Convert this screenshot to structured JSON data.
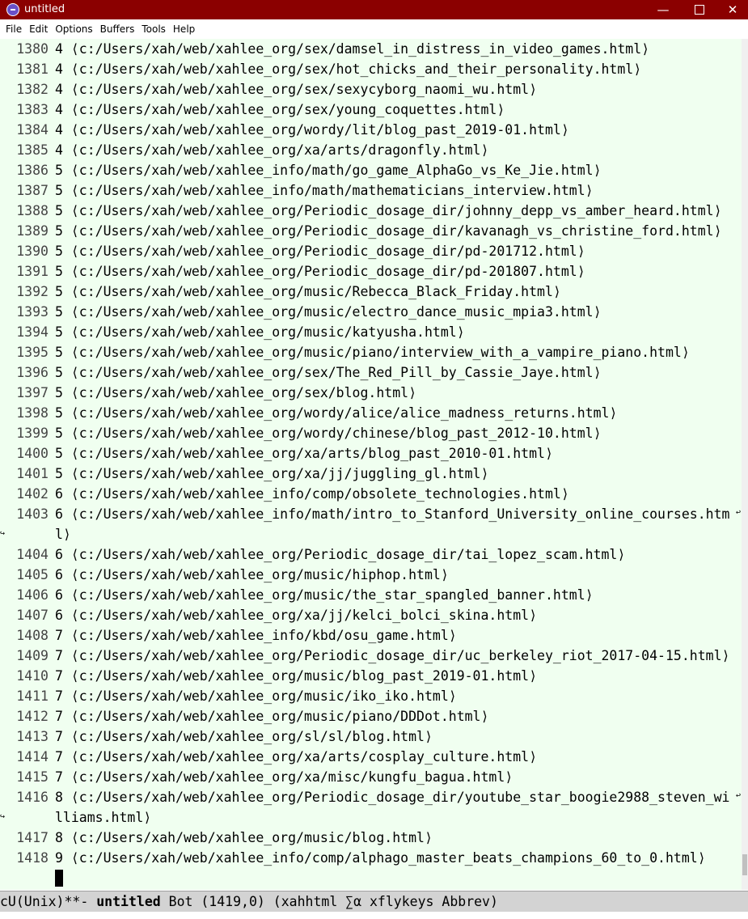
{
  "window": {
    "title": "untitled",
    "minimize_glyph": "—",
    "close_glyph": "✕"
  },
  "menu": [
    "File",
    "Edit",
    "Options",
    "Buffers",
    "Tools",
    "Help"
  ],
  "lines": [
    {
      "num": "1380",
      "text": "4 ⟨c:/Users/xah/web/xahlee_org/sex/damsel_in_distress_in_video_games.html⟩"
    },
    {
      "num": "1381",
      "text": "4 ⟨c:/Users/xah/web/xahlee_org/sex/hot_chicks_and_their_personality.html⟩"
    },
    {
      "num": "1382",
      "text": "4 ⟨c:/Users/xah/web/xahlee_org/sex/sexycyborg_naomi_wu.html⟩"
    },
    {
      "num": "1383",
      "text": "4 ⟨c:/Users/xah/web/xahlee_org/sex/young_coquettes.html⟩"
    },
    {
      "num": "1384",
      "text": "4 ⟨c:/Users/xah/web/xahlee_org/wordy/lit/blog_past_2019-01.html⟩"
    },
    {
      "num": "1385",
      "text": "4 ⟨c:/Users/xah/web/xahlee_org/xa/arts/dragonfly.html⟩"
    },
    {
      "num": "1386",
      "text": "5 ⟨c:/Users/xah/web/xahlee_info/math/go_game_AlphaGo_vs_Ke_Jie.html⟩"
    },
    {
      "num": "1387",
      "text": "5 ⟨c:/Users/xah/web/xahlee_info/math/mathematicians_interview.html⟩"
    },
    {
      "num": "1388",
      "text": "5 ⟨c:/Users/xah/web/xahlee_org/Periodic_dosage_dir/johnny_depp_vs_amber_heard.html⟩"
    },
    {
      "num": "1389",
      "text": "5 ⟨c:/Users/xah/web/xahlee_org/Periodic_dosage_dir/kavanagh_vs_christine_ford.html⟩"
    },
    {
      "num": "1390",
      "text": "5 ⟨c:/Users/xah/web/xahlee_org/Periodic_dosage_dir/pd-201712.html⟩"
    },
    {
      "num": "1391",
      "text": "5 ⟨c:/Users/xah/web/xahlee_org/Periodic_dosage_dir/pd-201807.html⟩"
    },
    {
      "num": "1392",
      "text": "5 ⟨c:/Users/xah/web/xahlee_org/music/Rebecca_Black_Friday.html⟩"
    },
    {
      "num": "1393",
      "text": "5 ⟨c:/Users/xah/web/xahlee_org/music/electro_dance_music_mpia3.html⟩"
    },
    {
      "num": "1394",
      "text": "5 ⟨c:/Users/xah/web/xahlee_org/music/katyusha.html⟩"
    },
    {
      "num": "1395",
      "text": "5 ⟨c:/Users/xah/web/xahlee_org/music/piano/interview_with_a_vampire_piano.html⟩"
    },
    {
      "num": "1396",
      "text": "5 ⟨c:/Users/xah/web/xahlee_org/sex/The_Red_Pill_by_Cassie_Jaye.html⟩"
    },
    {
      "num": "1397",
      "text": "5 ⟨c:/Users/xah/web/xahlee_org/sex/blog.html⟩"
    },
    {
      "num": "1398",
      "text": "5 ⟨c:/Users/xah/web/xahlee_org/wordy/alice/alice_madness_returns.html⟩"
    },
    {
      "num": "1399",
      "text": "5 ⟨c:/Users/xah/web/xahlee_org/wordy/chinese/blog_past_2012-10.html⟩"
    },
    {
      "num": "1400",
      "text": "5 ⟨c:/Users/xah/web/xahlee_org/xa/arts/blog_past_2010-01.html⟩"
    },
    {
      "num": "1401",
      "text": "5 ⟨c:/Users/xah/web/xahlee_org/xa/jj/juggling_gl.html⟩"
    },
    {
      "num": "1402",
      "text": "6 ⟨c:/Users/xah/web/xahlee_info/comp/obsolete_technologies.html⟩"
    },
    {
      "num": "1403",
      "text": "6 ⟨c:/Users/xah/web/xahlee_info/math/intro_to_Stanford_University_online_courses.htm",
      "cont": "l⟩"
    },
    {
      "num": "1404",
      "text": "6 ⟨c:/Users/xah/web/xahlee_org/Periodic_dosage_dir/tai_lopez_scam.html⟩"
    },
    {
      "num": "1405",
      "text": "6 ⟨c:/Users/xah/web/xahlee_org/music/hiphop.html⟩"
    },
    {
      "num": "1406",
      "text": "6 ⟨c:/Users/xah/web/xahlee_org/music/the_star_spangled_banner.html⟩"
    },
    {
      "num": "1407",
      "text": "6 ⟨c:/Users/xah/web/xahlee_org/xa/jj/kelci_bolci_skina.html⟩"
    },
    {
      "num": "1408",
      "text": "7 ⟨c:/Users/xah/web/xahlee_info/kbd/osu_game.html⟩"
    },
    {
      "num": "1409",
      "text": "7 ⟨c:/Users/xah/web/xahlee_org/Periodic_dosage_dir/uc_berkeley_riot_2017-04-15.html⟩"
    },
    {
      "num": "1410",
      "text": "7 ⟨c:/Users/xah/web/xahlee_org/music/blog_past_2019-01.html⟩"
    },
    {
      "num": "1411",
      "text": "7 ⟨c:/Users/xah/web/xahlee_org/music/iko_iko.html⟩"
    },
    {
      "num": "1412",
      "text": "7 ⟨c:/Users/xah/web/xahlee_org/music/piano/DDDot.html⟩"
    },
    {
      "num": "1413",
      "text": "7 ⟨c:/Users/xah/web/xahlee_org/sl/sl/blog.html⟩"
    },
    {
      "num": "1414",
      "text": "7 ⟨c:/Users/xah/web/xahlee_org/xa/arts/cosplay_culture.html⟩"
    },
    {
      "num": "1415",
      "text": "7 ⟨c:/Users/xah/web/xahlee_org/xa/misc/kungfu_bagua.html⟩"
    },
    {
      "num": "1416",
      "text": "8 ⟨c:/Users/xah/web/xahlee_org/Periodic_dosage_dir/youtube_star_boogie2988_steven_wi",
      "cont": "lliams.html⟩"
    },
    {
      "num": "1417",
      "text": "8 ⟨c:/Users/xah/web/xahlee_org/music/blog.html⟩"
    },
    {
      "num": "1418",
      "text": "9 ⟨c:/Users/xah/web/xahlee_info/comp/alphago_master_beats_champions_60_to_0.html⟩"
    }
  ],
  "modeline": {
    "prefix": "cU(Unix)**- ",
    "buffer_name": "untitled",
    "rest": " Bot (1419,0) (xahhtml ∑α xflykeys Abbrev)"
  },
  "colors": {
    "titlebar_bg": "#8b0000",
    "editor_bg": "#f0fff0",
    "modeline_bg": "#d3d3d3"
  }
}
